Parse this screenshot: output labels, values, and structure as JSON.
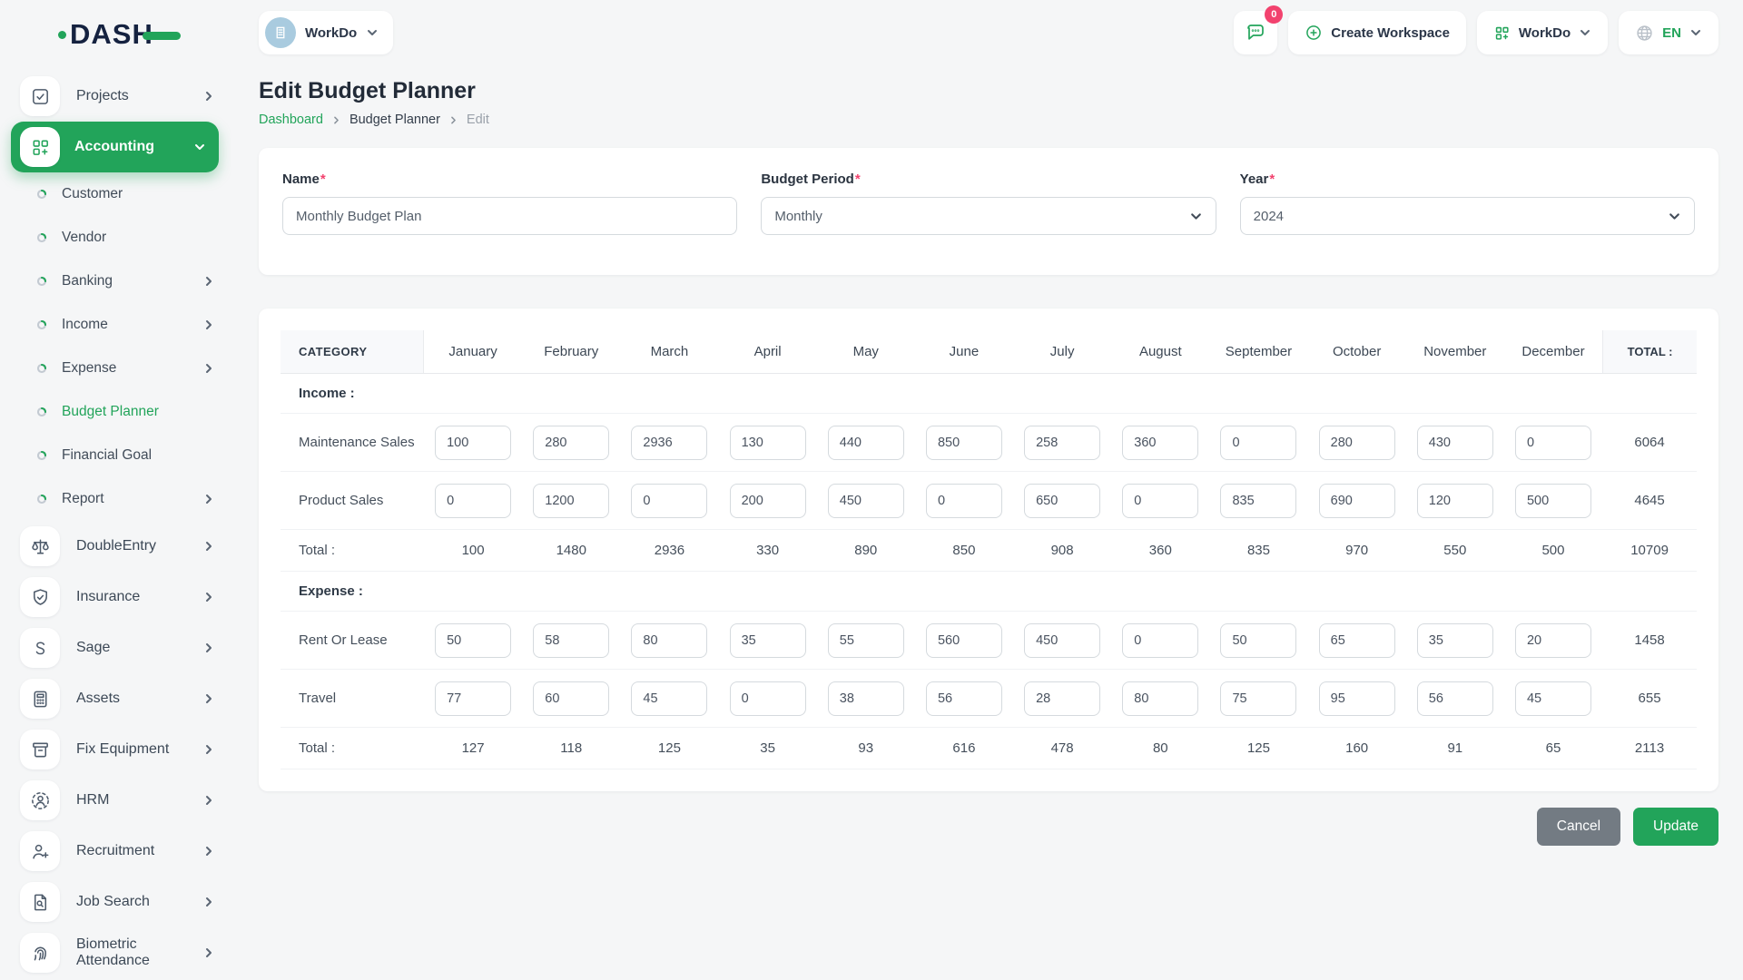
{
  "logo": {
    "text": "DASH"
  },
  "colors": {
    "accent_green": "#22a45a",
    "badge_red": "#f2426e",
    "dark_navy": "#152240"
  },
  "icons": {
    "workspace_avatar": "building-icon",
    "messages": "chat-bubble-icon",
    "create_workspace": "plus-circle-icon",
    "app_menu": "grid-plus-icon",
    "language": "globe-icon",
    "nav_expand": "chevron-right-icon",
    "nav_open": "chevron-down-icon"
  },
  "topbar": {
    "workspace": {
      "label": "WorkDo"
    },
    "chat_badge": "0",
    "create_workspace": "Create Workspace",
    "app_menu": "WorkDo",
    "language": "EN"
  },
  "sidebar": {
    "top_items": [
      {
        "label": "Projects"
      },
      {
        "label": "Accounting"
      }
    ],
    "accounting_sub": [
      {
        "label": "Customer"
      },
      {
        "label": "Vendor"
      },
      {
        "label": "Banking"
      },
      {
        "label": "Income"
      },
      {
        "label": "Expense"
      },
      {
        "label": "Budget Planner"
      },
      {
        "label": "Financial Goal"
      },
      {
        "label": "Report"
      }
    ],
    "module_items": [
      {
        "label": "DoubleEntry"
      },
      {
        "label": "Insurance"
      },
      {
        "label": "Sage"
      },
      {
        "label": "Assets"
      },
      {
        "label": "Fix Equipment"
      },
      {
        "label": "HRM"
      },
      {
        "label": "Recruitment"
      },
      {
        "label": "Job Search"
      },
      {
        "label": "Biometric Attendance"
      }
    ]
  },
  "page": {
    "title": "Edit Budget Planner",
    "breadcrumb": [
      "Dashboard",
      "Budget Planner",
      "Edit"
    ]
  },
  "form": {
    "name": {
      "label": "Name",
      "required": "*",
      "value": "Monthly Budget Plan"
    },
    "period": {
      "label": "Budget Period",
      "required": "*",
      "value": "Monthly"
    },
    "year": {
      "label": "Year",
      "required": "*",
      "value": "2024"
    }
  },
  "table": {
    "category_header": "CATEGORY",
    "total_header": "TOTAL :",
    "columns": [
      "January",
      "February",
      "March",
      "April",
      "May",
      "June",
      "July",
      "August",
      "September",
      "October",
      "November",
      "December"
    ],
    "sections": [
      {
        "heading": "Income :",
        "rows": [
          {
            "label": "Maintenance Sales",
            "values": [
              100,
              280,
              2936,
              130,
              440,
              850,
              258,
              360,
              0,
              280,
              430,
              0
            ],
            "total": 6064
          },
          {
            "label": "Product Sales",
            "values": [
              0,
              1200,
              0,
              200,
              450,
              0,
              650,
              0,
              835,
              690,
              120,
              500
            ],
            "total": 4645
          }
        ],
        "total_row": {
          "label": "Total :",
          "values": [
            100,
            1480,
            2936,
            330,
            890,
            850,
            908,
            360,
            835,
            970,
            550,
            500
          ],
          "total": 10709
        }
      },
      {
        "heading": "Expense :",
        "rows": [
          {
            "label": "Rent Or Lease",
            "values": [
              50,
              58,
              80,
              35,
              55,
              560,
              450,
              0,
              50,
              65,
              35,
              20
            ],
            "total": 1458
          },
          {
            "label": "Travel",
            "values": [
              77,
              60,
              45,
              0,
              38,
              56,
              28,
              80,
              75,
              95,
              56,
              45
            ],
            "total": 655
          }
        ],
        "total_row": {
          "label": "Total :",
          "values": [
            127,
            118,
            125,
            35,
            93,
            616,
            478,
            80,
            125,
            160,
            91,
            65
          ],
          "total": 2113
        }
      }
    ]
  },
  "actions": {
    "cancel": "Cancel",
    "update": "Update"
  }
}
